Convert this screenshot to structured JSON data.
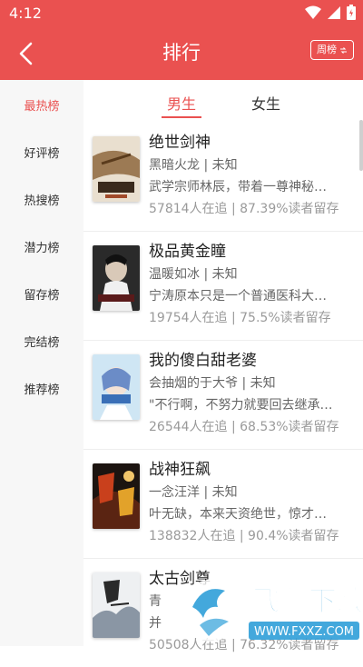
{
  "status": {
    "time": "4:12"
  },
  "header": {
    "title": "排行",
    "period_button": "周榜"
  },
  "sidebar": {
    "items": [
      {
        "label": "最热榜",
        "active": true
      },
      {
        "label": "好评榜"
      },
      {
        "label": "热搜榜"
      },
      {
        "label": "潜力榜"
      },
      {
        "label": "留存榜"
      },
      {
        "label": "完结榜"
      },
      {
        "label": "推荐榜"
      }
    ]
  },
  "tabs": [
    {
      "label": "男生",
      "active": true
    },
    {
      "label": "女生"
    }
  ],
  "books": [
    {
      "title": "绝世剑神",
      "author_status": "黑暗火龙 | 未知",
      "desc": "武学宗师林辰，带着一尊神秘…",
      "stats": "57814人在追 | 87.39%读者留存"
    },
    {
      "title": "极品黄金瞳",
      "author_status": "温暖如冰 | 未知",
      "desc": "宁涛原本只是一个普通医科大…",
      "stats": "19754人在追 | 75.5%读者留存"
    },
    {
      "title": "我的傻白甜老婆",
      "author_status": "会抽烟的于大爷 | 未知",
      "desc": "\"不行啊，不努力就要回去继承…",
      "stats": "26544人在追 | 68.53%读者留存"
    },
    {
      "title": "战神狂飙",
      "author_status": "一念汪洋 | 未知",
      "desc": "叶无缺，本来天资绝世，惊才…",
      "stats": "138832人在追 | 90.4%读者留存"
    },
    {
      "title": "太古剑尊",
      "author_status": "青",
      "desc": "并",
      "stats": "50508人在追 | 76.32%读者留存"
    }
  ],
  "watermark": {
    "text": "飞翔下载",
    "url": "WWW.FXXZ.COM"
  },
  "colors": {
    "accent": "#ea5150",
    "sidebar_bg": "#f7f7f7"
  }
}
